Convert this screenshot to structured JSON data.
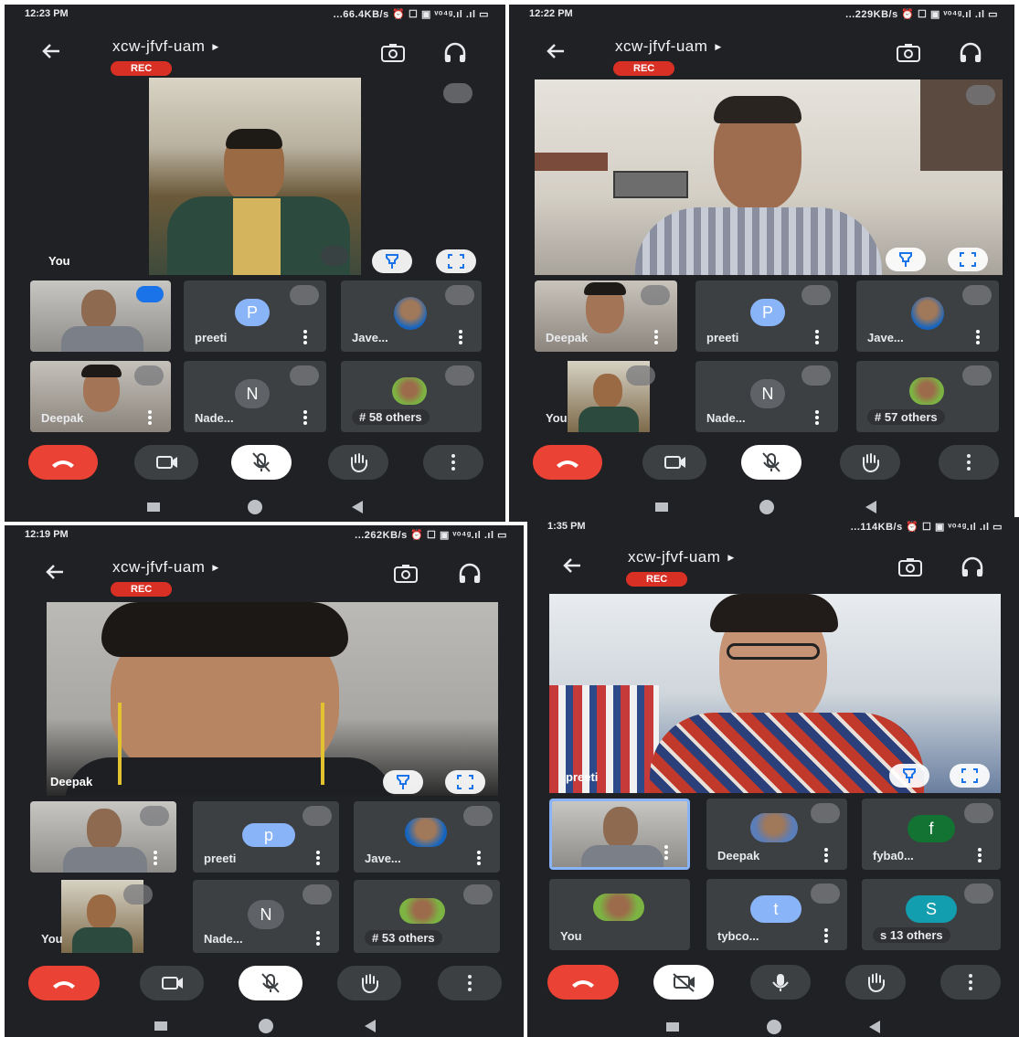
{
  "screens": [
    {
      "time": "12:23 PM",
      "status_right": "...66.4KB/s ⏰ ☐ ▣ ᵛᵒ⁴ᵍ.ıl .ıl ▭",
      "meeting_title": "xcw-jfvf-uam",
      "rec_label": "REC",
      "main_name": "You",
      "tiles": [
        {
          "name": "",
          "kind": "video"
        },
        {
          "name": "preeti",
          "kind": "avatar",
          "initial": "P"
        },
        {
          "name": "Jave...",
          "kind": "photo"
        },
        {
          "name": "Deepak",
          "kind": "video"
        },
        {
          "name": "Nade...",
          "kind": "avatar",
          "initial": "N"
        },
        {
          "name": "#     58 others",
          "kind": "photo"
        }
      ]
    },
    {
      "time": "12:22 PM",
      "status_right": "...229KB/s ⏰ ☐ ▣ ᵛᵒ⁴ᵍ.ıl .ıl ▭",
      "meeting_title": "xcw-jfvf-uam",
      "rec_label": "REC",
      "main_name": "",
      "tiles": [
        {
          "name": "Deepak",
          "kind": "video"
        },
        {
          "name": "preeti",
          "kind": "avatar",
          "initial": "P"
        },
        {
          "name": "Jave...",
          "kind": "photo"
        },
        {
          "name": "You",
          "kind": "video"
        },
        {
          "name": "Nade...",
          "kind": "avatar",
          "initial": "N"
        },
        {
          "name": "#     57 others",
          "kind": "photo"
        }
      ]
    },
    {
      "time": "12:19 PM",
      "status_right": "...262KB/s ⏰ ☐ ▣ ᵛᵒ⁴ᵍ.ıl .ıl ▭",
      "meeting_title": "xcw-jfvf-uam",
      "rec_label": "REC",
      "main_name": "Deepak",
      "tiles": [
        {
          "name": "",
          "kind": "video"
        },
        {
          "name": "preeti",
          "kind": "avatar",
          "initial": "p"
        },
        {
          "name": "Jave...",
          "kind": "photo"
        },
        {
          "name": "You",
          "kind": "video"
        },
        {
          "name": "Nade...",
          "kind": "avatar",
          "initial": "N"
        },
        {
          "name": "#     53 others",
          "kind": "photo"
        }
      ]
    },
    {
      "time": "1:35 PM",
      "status_right": "...114KB/s ⏰ ☐ ▣ ᵛᵒ⁴ᵍ.ıl .ıl ▭",
      "meeting_title": "xcw-jfvf-uam",
      "rec_label": "REC",
      "main_name": "preeti",
      "tiles": [
        {
          "name": "",
          "kind": "video"
        },
        {
          "name": "Deepak",
          "kind": "photo"
        },
        {
          "name": "fyba0...",
          "kind": "avatar",
          "initial": "f"
        },
        {
          "name": "You",
          "kind": "photo"
        },
        {
          "name": "tybco...",
          "kind": "avatar",
          "initial": "t"
        },
        {
          "name": "s     13 others",
          "kind": "avatar",
          "initial": "S"
        }
      ]
    }
  ],
  "colors": {
    "background": "#202124",
    "tile": "#3c4043",
    "end_call": "#ea4335",
    "rec": "#d93025",
    "avatar_p": "#8ab4f8",
    "avatar_n": "#5f6368",
    "avatar_f": "#137333",
    "avatar_s": "#129eaf",
    "avatar_t": "#8ab4f8"
  },
  "icons": [
    "back-arrow-icon",
    "flip-camera-icon",
    "headphones-icon",
    "pin-icon",
    "fullscreen-icon",
    "mic-off-icon",
    "more-vert-icon",
    "end-call-icon",
    "camera-icon",
    "hand-raise-icon",
    "camera-off-icon",
    "mic-icon"
  ]
}
